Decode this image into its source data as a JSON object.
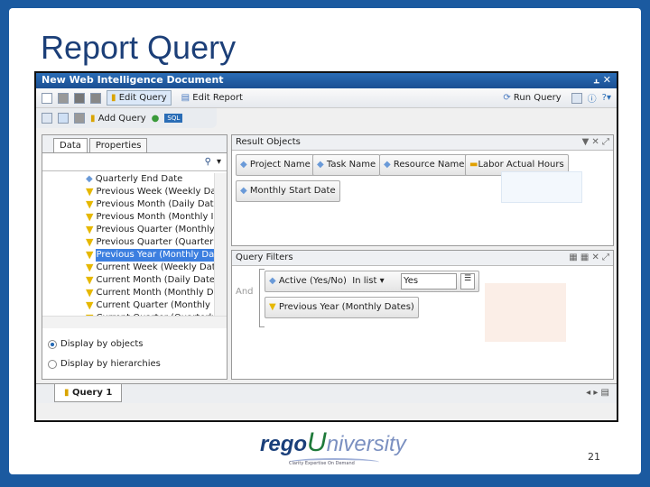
{
  "slide": {
    "title": "Report Query",
    "page_number": "21"
  },
  "logo": {
    "text_rego": "rego",
    "text_u": "U",
    "text_rest": "niversity",
    "tagline": "Clarity Expertise On Demand"
  },
  "window": {
    "title": "New Web Intelligence Document",
    "pin": "⫠",
    "close": "✕"
  },
  "toolbar": {
    "edit_query": "Edit Query",
    "edit_report": "Edit Report",
    "run_query": "Run Query"
  },
  "toolbar2": {
    "add_query": "Add Query",
    "sql": "SQL"
  },
  "left_panel": {
    "tabs": [
      "Data",
      "Properties"
    ],
    "items": [
      {
        "label": "Quarterly End Date",
        "type": "dim"
      },
      {
        "label": "Previous Week (Weekly Dat",
        "type": "filter"
      },
      {
        "label": "Previous Month (Daily Date",
        "type": "filter"
      },
      {
        "label": "Previous Month (Monthly I",
        "type": "filter"
      },
      {
        "label": "Previous Quarter (Monthly",
        "type": "filter"
      },
      {
        "label": "Previous Quarter (Quarterly",
        "type": "filter"
      },
      {
        "label": "Previous Year (Monthly Dat",
        "type": "filter",
        "selected": true
      },
      {
        "label": "Current Week (Weekly Date",
        "type": "filter"
      },
      {
        "label": "Current Month (Daily Date)",
        "type": "filter"
      },
      {
        "label": "Current Month (Monthly D",
        "type": "filter"
      },
      {
        "label": "Current Quarter (Monthly D",
        "type": "filter"
      },
      {
        "label": "Current Quarter (Quarterly",
        "type": "filter"
      }
    ],
    "radio_objects": "Display by objects",
    "radio_hierarchies": "Display by hierarchies"
  },
  "result_objects": {
    "title": "Result Objects",
    "chips": [
      "Project Name",
      "Task Name",
      "Resource Name",
      "Labor Actual Hours",
      "Monthly Start Date"
    ]
  },
  "query_filters": {
    "title": "Query Filters",
    "operator": "And",
    "filter1": {
      "object": "Active (Yes/No)",
      "op": "In list",
      "value": "Yes"
    },
    "filter2": "Previous Year (Monthly Dates)"
  },
  "query_tab": "Query 1"
}
